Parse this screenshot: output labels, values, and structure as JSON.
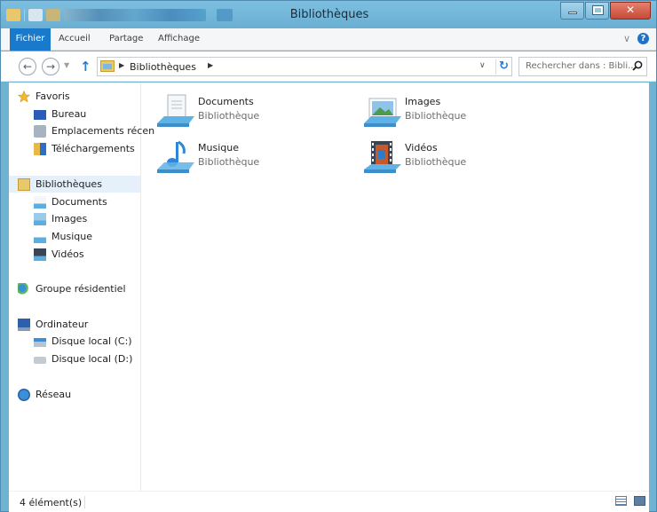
{
  "window": {
    "title": "Bibliothèques"
  },
  "ribbon": {
    "file_tab": "Fichier",
    "tabs": [
      "Accueil",
      "Partage",
      "Affichage"
    ],
    "expand_icon": "chevron-down-icon",
    "help_icon": "help-icon",
    "help_glyph": "?"
  },
  "address": {
    "path": "Bibliothèques",
    "search_placeholder": "Rechercher dans : Bibli..."
  },
  "navpane": {
    "favoris": "Favoris",
    "favoris_items": [
      "Bureau",
      "Emplacements récen",
      "Téléchargements"
    ],
    "bibliotheques": "Bibliothèques",
    "bibliotheques_items": [
      "Documents",
      "Images",
      "Musique",
      "Vidéos"
    ],
    "groupe": "Groupe résidentiel",
    "ordinateur": "Ordinateur",
    "ordinateur_items": [
      "Disque local (C:)",
      "Disque local (D:)"
    ],
    "reseau": "Réseau"
  },
  "libraries": [
    {
      "name": "Documents",
      "type": "Bibliothèque",
      "icon": "documents-library-icon"
    },
    {
      "name": "Images",
      "type": "Bibliothèque",
      "icon": "images-library-icon"
    },
    {
      "name": "Musique",
      "type": "Bibliothèque",
      "icon": "music-library-icon"
    },
    {
      "name": "Vidéos",
      "type": "Bibliothèque",
      "icon": "videos-library-icon"
    }
  ],
  "status": {
    "count": "4 élément(s)"
  },
  "colors": {
    "titlebar": "#6aaed2",
    "file_tab": "#1979ca",
    "selection": "#e5f0fb",
    "close_button": "#c64a36"
  }
}
